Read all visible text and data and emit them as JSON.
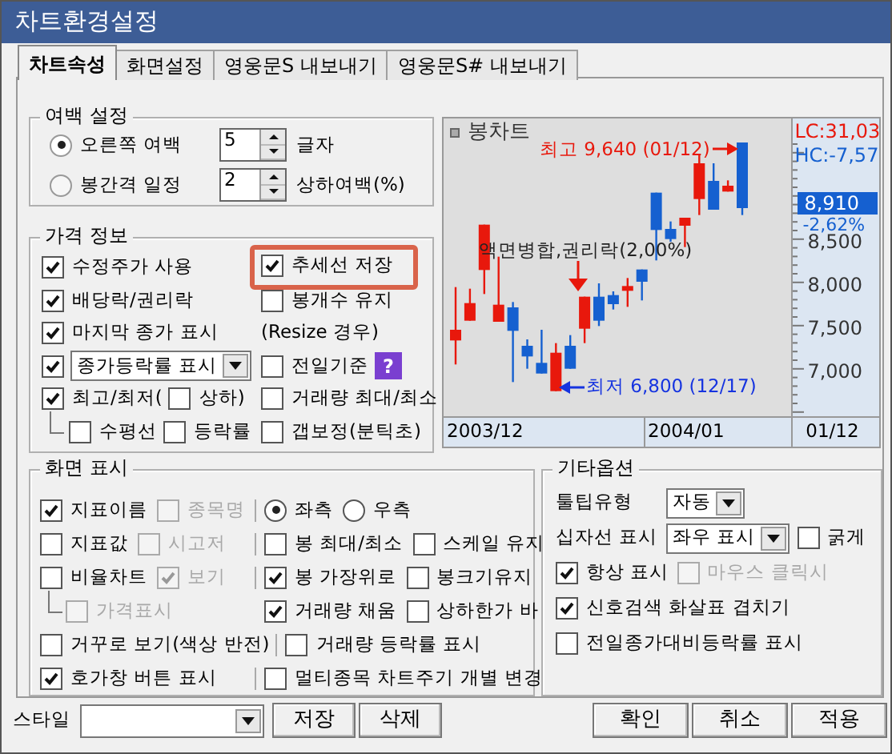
{
  "window": {
    "title": "차트환경설정"
  },
  "tabs": [
    {
      "label": "차트속성",
      "selected": true
    },
    {
      "label": "화면설정",
      "selected": false
    },
    {
      "label": "영웅문S 내보내기",
      "selected": false
    },
    {
      "label": "영웅문S# 내보내기",
      "selected": false
    }
  ],
  "margin_group": {
    "title": "여백 설정",
    "rows": [
      {
        "label": "오른쪽 여백",
        "selected": true,
        "value": "5",
        "unit": "글자"
      },
      {
        "label": "봉간격 일정",
        "selected": false,
        "value": "2",
        "unit": "상하여백(%)"
      }
    ]
  },
  "price_group": {
    "title": "가격 정보",
    "rows": [
      {
        "kind": "main",
        "left": [
          {
            "kind": "checkbox",
            "label": "수정주가 사용",
            "checked": true
          }
        ],
        "right": [
          {
            "kind": "checkbox",
            "label": "추세선 저장",
            "checked": true,
            "highlighted": true
          }
        ]
      },
      {
        "kind": "main",
        "left": [
          {
            "kind": "checkbox",
            "label": "배당락/권리락",
            "checked": true
          }
        ],
        "right": [
          {
            "kind": "checkbox",
            "label": "봉개수 유지",
            "checked": false,
            "highlighted": false
          }
        ]
      },
      {
        "kind": "main",
        "left": [
          {
            "kind": "checkbox",
            "label": "마지막 종가 표시",
            "checked": true
          }
        ],
        "right": [
          {
            "kind": "text",
            "label": "(Resize 경우)"
          }
        ]
      },
      {
        "kind": "main",
        "left": [
          {
            "kind": "checkbox",
            "checked": true
          },
          {
            "kind": "select",
            "value": "종가등락률 표시"
          }
        ],
        "right": [
          {
            "kind": "checkbox",
            "label": "전일기준",
            "checked": false,
            "highlighted": false
          },
          {
            "kind": "help",
            "label": "?"
          }
        ]
      },
      {
        "kind": "main",
        "left": [
          {
            "kind": "checkbox",
            "label": "최고/최저(",
            "checked": true
          },
          {
            "kind": "checkbox",
            "label": "상하)",
            "checked": false
          }
        ],
        "right": [
          {
            "kind": "checkbox",
            "label": "거래량 최대/최소",
            "checked": false,
            "highlighted": false
          }
        ]
      },
      {
        "kind": "sub",
        "left": [
          {
            "kind": "checkbox",
            "label": "수평선",
            "checked": false
          },
          {
            "kind": "checkbox",
            "label": "등락률",
            "checked": false
          }
        ],
        "right": [
          {
            "kind": "checkbox",
            "label": "갭보정(분틱초)",
            "checked": false,
            "highlighted": false
          }
        ]
      }
    ]
  },
  "chart": {
    "title": "봉차트",
    "high_note": "최고 9,640 (01/12)",
    "event_note": "액면병합,권리락(2,00%)",
    "low_note": "최저 6,800 (12/17)",
    "lc": "LC:31,03",
    "hc": "HC:-7,57",
    "price": "8,910",
    "change": "-2,62%",
    "y_ticks": [
      "8,500",
      "8,000",
      "7,500",
      "7,000"
    ],
    "dates": [
      "2003/12",
      "2004/01"
    ],
    "last_date": "01/12"
  },
  "display_group": {
    "title": "화면 표시",
    "rows": [
      {
        "kind": "main",
        "left": [
          {
            "kind": "checkbox",
            "label": "지표이름",
            "checked": true,
            "disabled": false
          },
          {
            "kind": "checkbox",
            "label": "종목명",
            "checked": false,
            "disabled": true
          }
        ],
        "right": [
          {
            "kind": "radio",
            "label": "좌측",
            "selected": true
          },
          {
            "kind": "radio",
            "label": "우측",
            "selected": false
          }
        ]
      },
      {
        "kind": "main",
        "left": [
          {
            "kind": "checkbox",
            "label": "지표값",
            "checked": false,
            "disabled": false
          },
          {
            "kind": "checkbox",
            "label": "시고저",
            "checked": false,
            "disabled": true
          }
        ],
        "right": [
          {
            "kind": "checkbox",
            "label": "봉 최대/최소",
            "checked": false,
            "disabled": false
          },
          {
            "kind": "checkbox",
            "label": "스케일 유지",
            "checked": false,
            "disabled": false
          }
        ]
      },
      {
        "kind": "main",
        "left": [
          {
            "kind": "checkbox",
            "label": "비율차트",
            "checked": false,
            "disabled": false
          },
          {
            "kind": "checkbox",
            "label": "보기",
            "checked": true,
            "disabled": true
          }
        ],
        "right": [
          {
            "kind": "checkbox",
            "label": "봉 가장위로",
            "checked": true,
            "disabled": false
          },
          {
            "kind": "checkbox",
            "label": "봉크기유지",
            "checked": false,
            "disabled": false
          }
        ]
      },
      {
        "kind": "sub",
        "left": [
          {
            "kind": "checkbox",
            "label": "가격표시",
            "checked": false,
            "disabled": true
          }
        ],
        "right": [
          {
            "kind": "checkbox",
            "label": "거래량 채움",
            "checked": true,
            "disabled": false
          },
          {
            "kind": "checkbox",
            "label": "상하한가 바",
            "checked": false,
            "disabled": false
          }
        ]
      },
      {
        "kind": "main",
        "left": [
          {
            "kind": "checkbox",
            "label": "거꾸로 보기(색상 반전)",
            "checked": false,
            "disabled": false
          }
        ],
        "right": [
          {
            "kind": "checkbox",
            "label": "거래량 등락률 표시",
            "checked": false,
            "disabled": false
          }
        ]
      },
      {
        "kind": "main",
        "left": [
          {
            "kind": "checkbox",
            "label": "호가창 버튼 표시",
            "checked": true,
            "disabled": false
          }
        ],
        "right": [
          {
            "kind": "checkbox",
            "label": "멀티종목 차트주기 개별 변경",
            "checked": false,
            "disabled": false
          }
        ]
      }
    ]
  },
  "other_group": {
    "title": "기타옵션",
    "rows": [
      [
        {
          "kind": "text",
          "label": "툴팁유형"
        },
        {
          "kind": "select",
          "value": "자동"
        }
      ],
      [
        {
          "kind": "text",
          "label": "십자선 표시"
        },
        {
          "kind": "select",
          "value": "좌우 표시"
        },
        {
          "kind": "checkbox",
          "label": "굵게",
          "checked": false,
          "disabled": false
        }
      ],
      [
        {
          "kind": "checkbox",
          "label": "항상 표시",
          "checked": true,
          "disabled": false
        },
        {
          "kind": "checkbox",
          "label": "마우스 클릭시",
          "checked": false,
          "disabled": true
        }
      ],
      [
        {
          "kind": "checkbox",
          "label": "신호검색 화살표 겹치기",
          "checked": true,
          "disabled": false
        }
      ],
      [
        {
          "kind": "checkbox",
          "label": "전일종가대비등락률 표시",
          "checked": false,
          "disabled": false
        }
      ]
    ]
  },
  "footer": {
    "style_label": "스타일",
    "left_buttons": [
      "저장",
      "삭제"
    ],
    "right_buttons": [
      "확인",
      "취소",
      "적용"
    ]
  }
}
